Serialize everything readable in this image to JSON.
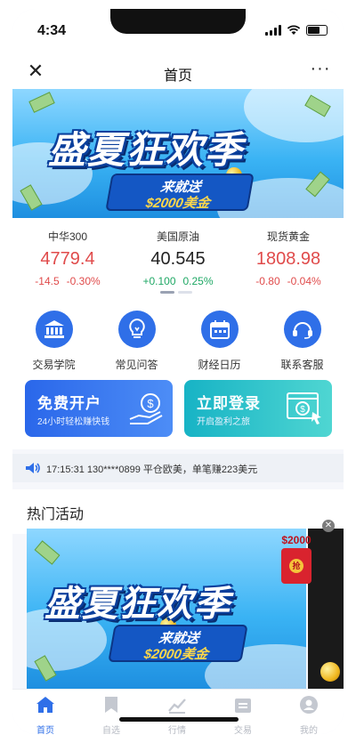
{
  "status_bar": {
    "time": "4:34"
  },
  "navbar": {
    "close_glyph": "✕",
    "title": "首页",
    "more_glyph": "···"
  },
  "banner": {
    "title": "盛夏狂欢季",
    "subtitle": "来就送",
    "prize": "$2000美金"
  },
  "market": [
    {
      "name": "中华300",
      "price": "4779.4",
      "change": "-14.5",
      "change_pct": "-0.30%",
      "direction": "down"
    },
    {
      "name": "美国原油",
      "price": "40.545",
      "change": "+0.100",
      "change_pct": "0.25%",
      "direction": "up"
    },
    {
      "name": "现货黄金",
      "price": "1808.98",
      "change": "-0.80",
      "change_pct": "-0.04%",
      "direction": "down"
    }
  ],
  "quick_menu": [
    {
      "label": "交易学院",
      "icon": "bank-icon"
    },
    {
      "label": "常见问答",
      "icon": "lightbulb-icon"
    },
    {
      "label": "财经日历",
      "icon": "calendar-icon"
    },
    {
      "label": "联系客服",
      "icon": "headset-icon"
    }
  ],
  "promo_cards": [
    {
      "title": "免费开户",
      "subtitle": "24小时轻松赚快钱",
      "icon": "hand-coin-icon"
    },
    {
      "title": "立即登录",
      "subtitle": "开启盈利之旅",
      "icon": "web-cursor-icon"
    }
  ],
  "ticker": {
    "text": "17:15:31 130****0899 平仓欧美，单笔赚223美元"
  },
  "hot_section": {
    "title": "热门活动"
  },
  "banner2": {
    "title": "盛夏狂欢季",
    "subtitle": "来就送",
    "prize": "$2000美金",
    "redpack_amount": "$2000",
    "redpack_seal": "抢"
  },
  "tabbar": [
    {
      "label": "首页",
      "icon": "home-icon",
      "active": true
    },
    {
      "label": "自选",
      "icon": "bookmark-icon",
      "active": false
    },
    {
      "label": "行情",
      "icon": "chart-icon",
      "active": false
    },
    {
      "label": "交易",
      "icon": "wallet-icon",
      "active": false
    },
    {
      "label": "我的",
      "icon": "profile-icon",
      "active": false
    }
  ],
  "colors": {
    "accent": "#2f6fe8",
    "down": "#e04b4b",
    "up": "#1fa865",
    "teal": "#17b3c5"
  }
}
